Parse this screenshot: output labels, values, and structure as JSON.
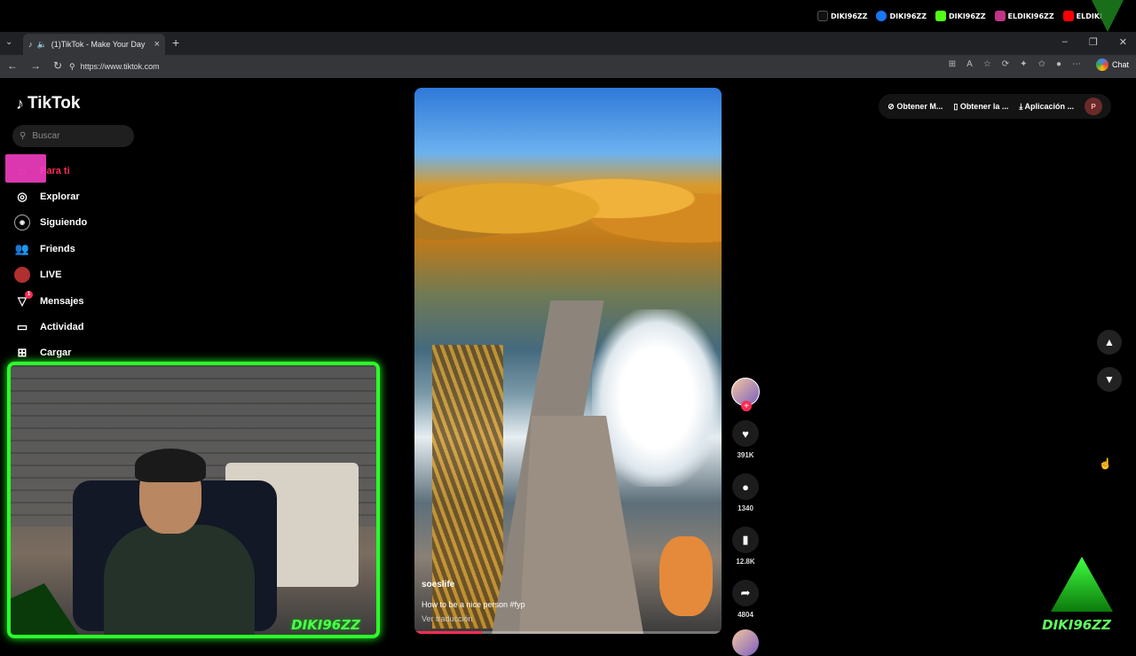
{
  "overlay": {
    "socials": [
      {
        "name": "tiktok",
        "handle": "DIKI96ZZ",
        "color": "#111111"
      },
      {
        "name": "facebook",
        "handle": "DIKI96ZZ",
        "color": "#1877f2"
      },
      {
        "name": "kick",
        "handle": "DIKI96ZZ",
        "color": "#53fc18"
      },
      {
        "name": "instagram",
        "handle": "ELDIKI96ZZ",
        "color": "#c13584"
      },
      {
        "name": "youtube",
        "handle": "ELDIKI",
        "color": "#ff0000"
      }
    ],
    "webcam_label": "DIKI96ZZ",
    "corner_logo_text": "DIKI96ZZ"
  },
  "browser": {
    "tab_title": "(1)TikTok - Make Your Day",
    "url": "https://www.tiktok.com",
    "chat_label": "Chat"
  },
  "tiktok": {
    "logo": "TikTok",
    "search_placeholder": "Buscar",
    "menu": [
      {
        "label": "Para ti",
        "icon": "home-icon",
        "active": true
      },
      {
        "label": "Explorar",
        "icon": "compass-icon"
      },
      {
        "label": "Siguiendo",
        "icon": "following-icon"
      },
      {
        "label": "Friends",
        "icon": "friends-icon"
      },
      {
        "label": "LIVE",
        "icon": "live-icon"
      },
      {
        "label": "Mensajes",
        "icon": "messages-icon",
        "badge": "1"
      },
      {
        "label": "Actividad",
        "icon": "activity-icon"
      },
      {
        "label": "Cargar",
        "icon": "upload-icon"
      }
    ],
    "header_buttons": [
      "Obtener M...",
      "Obtener la ...",
      "Aplicación ..."
    ],
    "profile_initial": "P",
    "video": {
      "username": "soeslife",
      "description": "How to be a nice person #fyp",
      "translate_link": "Ver traducción",
      "progress": 0.22
    },
    "actions": {
      "likes": "391K",
      "comments": "1340",
      "saves": "12.8K",
      "shares": "4804"
    }
  }
}
